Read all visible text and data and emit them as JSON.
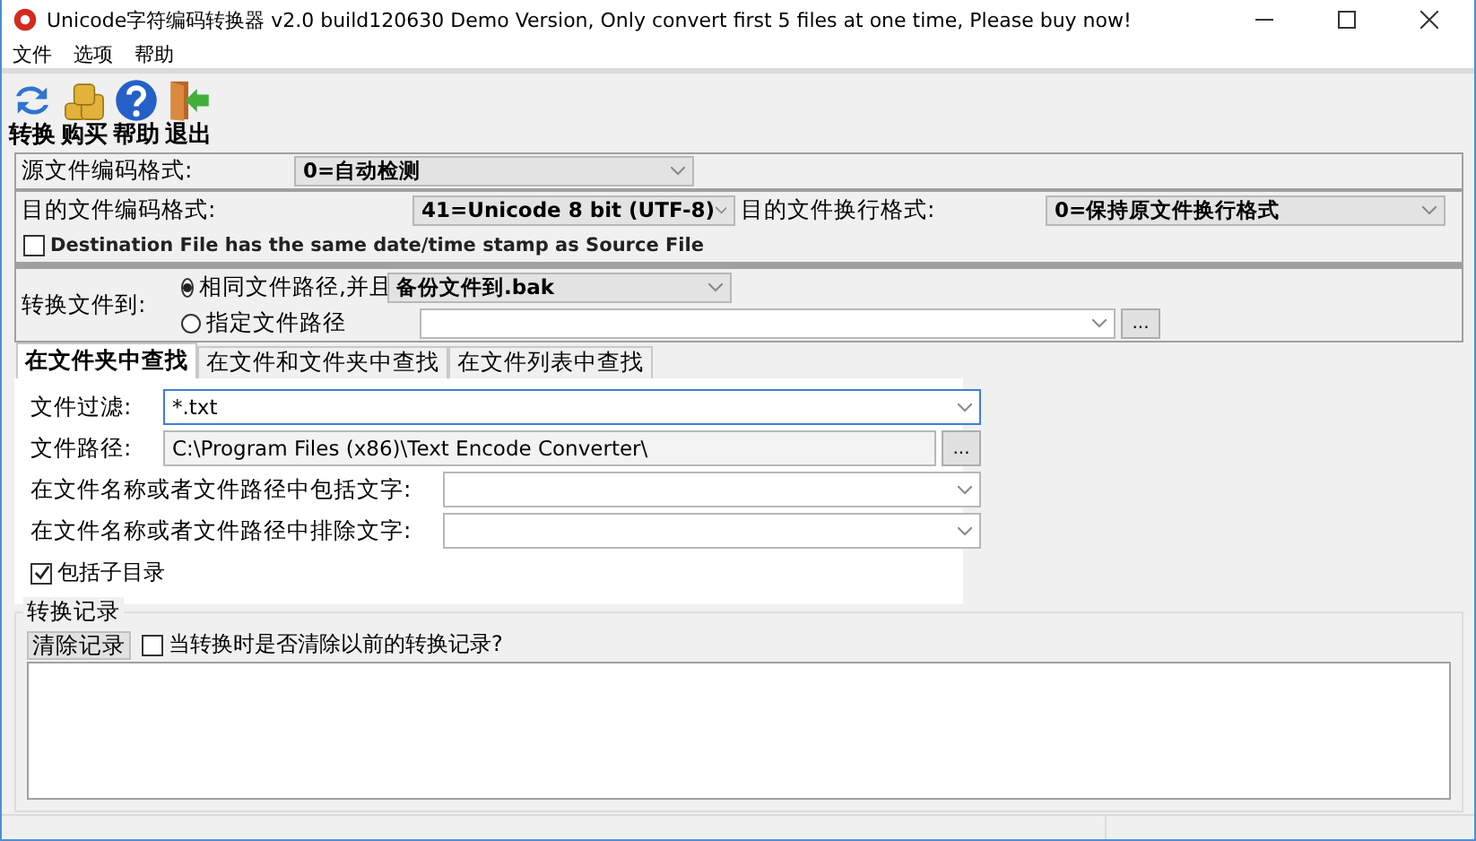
{
  "window": {
    "title": "Unicode字符编码转换器 v2.0 build120630 Demo Version, Only convert first 5 files at one time, Please buy now!"
  },
  "menu": [
    "文件",
    "选项",
    "帮助"
  ],
  "toolbar": [
    {
      "label": "转换",
      "kind": "convert"
    },
    {
      "label": "购买",
      "kind": "buy"
    },
    {
      "label": "帮助",
      "kind": "help"
    },
    {
      "label": "退出",
      "kind": "exit"
    }
  ],
  "source_encoding": {
    "label": "源文件编码格式:",
    "value": "0=自动检测"
  },
  "target_encoding": {
    "label": "目的文件编码格式:",
    "value": "41=Unicode 8 bit (UTF-8)"
  },
  "line_ending": {
    "label": "目的文件换行格式:",
    "value": "0=保持原文件换行格式"
  },
  "same_timestamp": {
    "label": "Destination File has the same date/time stamp as Source File",
    "checked": false
  },
  "convert_to": {
    "label": "转换文件到:",
    "browse_button": "...",
    "options": [
      {
        "label": "相同文件路径,并且",
        "selected": true,
        "kind": "backup",
        "value": "备份文件到.bak"
      },
      {
        "label": "指定文件路径",
        "selected": false,
        "kind": "path"
      }
    ]
  },
  "tabs": [
    {
      "label": "在文件夹中查找",
      "selected": true
    },
    {
      "label": "在文件和文件夹中查找",
      "selected": false
    },
    {
      "label": "在文件列表中查找",
      "selected": false
    }
  ],
  "search": {
    "fields": [
      {
        "label": "文件过滤:",
        "value": "*.txt",
        "kind": "combo"
      },
      {
        "label": "文件路径:",
        "value": "C:\\Program Files (x86)\\Text Encode Converter\\",
        "kind": "browse",
        "button": "..."
      },
      {
        "label": "在文件名称或者文件路径中包括文字:",
        "kind": "combo"
      },
      {
        "label": "在文件名称或者文件路径中排除文字:",
        "kind": "combo"
      }
    ],
    "include_subfolders": {
      "label": "包括子目录",
      "checked": true
    }
  },
  "log": {
    "title": "转换记录",
    "clear_button": "清除记录",
    "clear_on_convert": {
      "label": "当转换时是否清除以前的转换记录?",
      "checked": false
    }
  }
}
